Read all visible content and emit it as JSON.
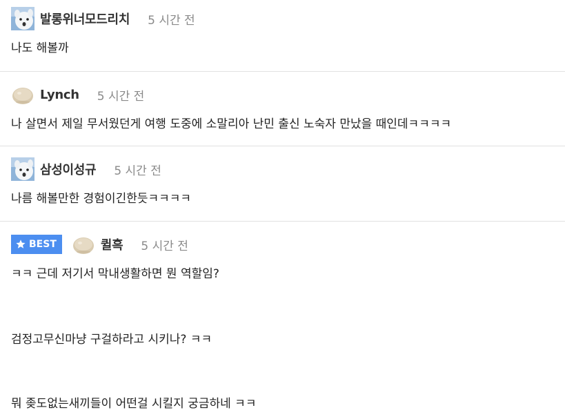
{
  "comments": [
    {
      "avatar": "snow-fox-avatar",
      "nickname": "발롱위너모드리치",
      "time": "5 시간 전",
      "lines": [
        "나도 해볼까"
      ]
    },
    {
      "avatar": "round-blob-avatar",
      "nickname": "Lynch",
      "time": "5 시간 전",
      "lines": [
        "나 살면서 제일 무서웠던게 여행 도중에 소말리아 난민 출신 노숙자 만났을 때인데ㅋㅋㅋㅋ"
      ]
    },
    {
      "avatar": "snow-fox-avatar",
      "nickname": "삼성이성규",
      "time": "5 시간 전",
      "lines": [
        "나름 해볼만한 경험이긴한듯ㅋㅋㅋㅋ"
      ]
    },
    {
      "best_label": "BEST",
      "best_icon": "star-icon",
      "avatar": "round-blob-avatar",
      "nickname": "퀼흑",
      "time": "5 시간 전",
      "lines": [
        "ㅋㅋ 근데 저기서 막내생활하면 뭔 역할임?",
        "검정고무신마냥 구걸하라고 시키나? ㅋㅋ",
        "뭐 좆도없는새끼들이 어떤걸 시킬지 궁금하네 ㅋㅋ"
      ]
    }
  ],
  "colors": {
    "best_badge": "#4c8ef0",
    "nickname": "#333333",
    "time": "#8a8a8a",
    "divider": "#e1e1e1"
  }
}
